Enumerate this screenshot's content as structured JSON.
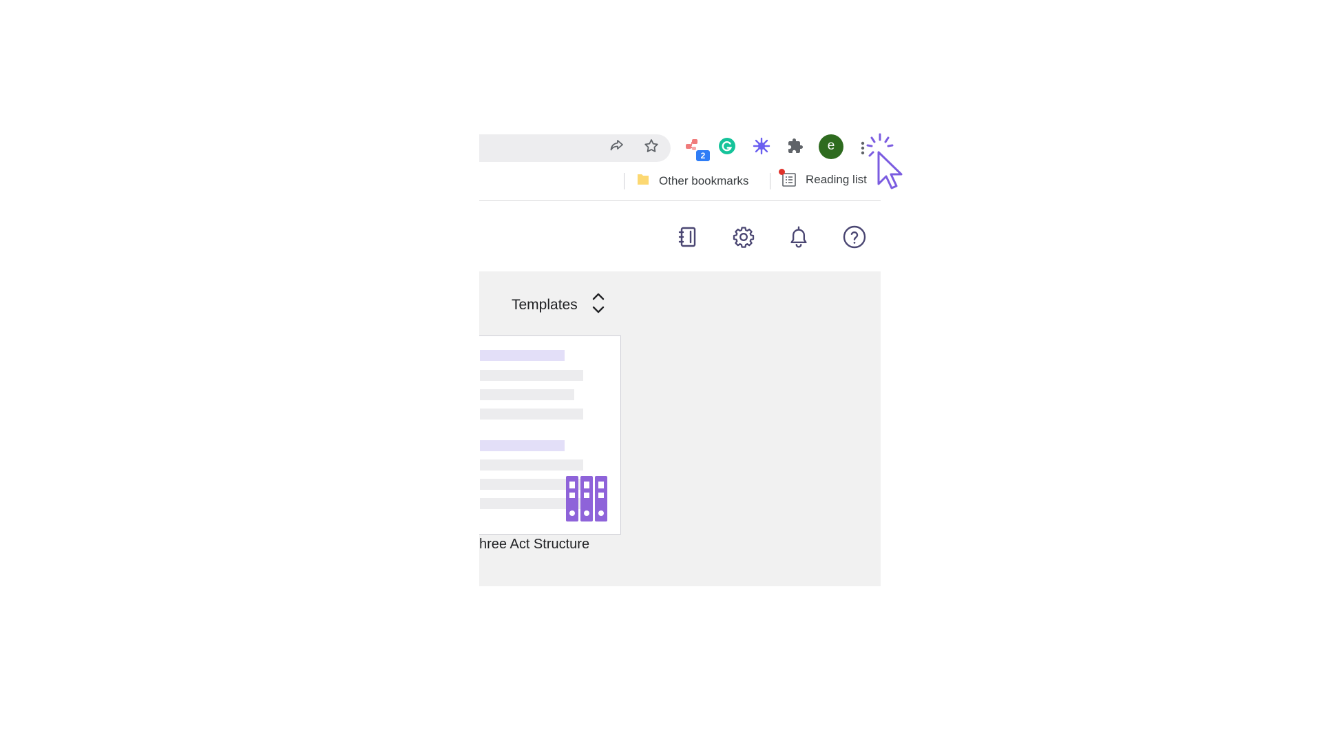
{
  "toolbar": {
    "icons": [
      "share-icon",
      "bookmark-star-icon",
      "extension-flow-icon",
      "grammarly-icon",
      "asterisk-extension-icon",
      "extensions-puzzle-icon",
      "magic-cursor-icon"
    ],
    "extension_badge": "2",
    "avatar_letter": "e"
  },
  "bookmarks_bar": {
    "other_bookmarks": "Other bookmarks",
    "reading_list": "Reading list"
  },
  "app_header": {
    "icons": [
      "notebook-icon",
      "settings-gear-icon",
      "notification-bell-icon",
      "help-question-icon"
    ]
  },
  "main": {
    "sort_label": "Templates",
    "template_card": {
      "caption": "hree Act Structure"
    }
  },
  "colors": {
    "accent": "#7b5ce0",
    "icon_purple": "#4a4672",
    "avatar_green": "#2e6b1f",
    "badge_blue": "#2f7df6",
    "panel_bg": "#f1f1f1"
  }
}
